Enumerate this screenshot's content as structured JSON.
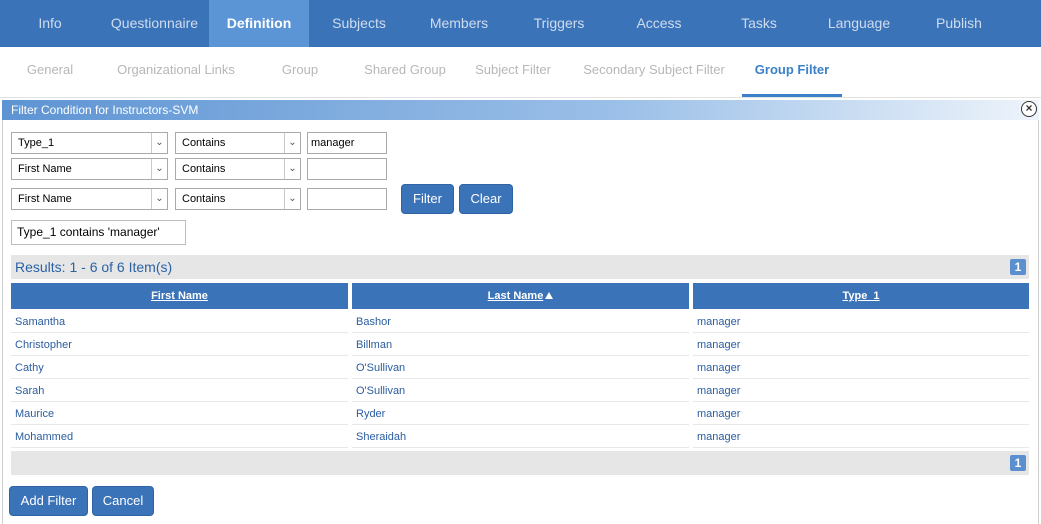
{
  "topnav": {
    "tabs": [
      "Info",
      "Questionnaire",
      "Definition",
      "Subjects",
      "Members",
      "Triggers",
      "Access",
      "Tasks",
      "Language",
      "Publish"
    ],
    "active": "Definition"
  },
  "subnav": {
    "tabs": [
      "General",
      "Organizational Links",
      "Group",
      "Shared Group",
      "Subject Filter",
      "Secondary Subject Filter",
      "Group Filter"
    ],
    "active": "Group Filter"
  },
  "dialog": {
    "title": "Filter Condition for Instructors-SVM",
    "close_icon": "close-icon"
  },
  "filters": [
    {
      "field": "Type_1",
      "operator": "Contains",
      "value": "manager"
    },
    {
      "field": "First Name",
      "operator": "Contains",
      "value": ""
    },
    {
      "field": "First Name",
      "operator": "Contains",
      "value": ""
    }
  ],
  "buttons": {
    "filter": "Filter",
    "clear": "Clear",
    "add_filter": "Add Filter",
    "cancel": "Cancel"
  },
  "summary": "Type_1 contains 'manager'",
  "results": {
    "label": "Results: 1 - 6 of 6 Item(s)",
    "page": "1"
  },
  "table": {
    "columns": [
      "First Name",
      "Last Name",
      "Type_1"
    ],
    "sort_icon": "sort-ascending-icon",
    "rows": [
      [
        "Samantha",
        "Bashor",
        "manager"
      ],
      [
        "Christopher",
        "Billman",
        "manager"
      ],
      [
        "Cathy",
        "O'Sullivan",
        "manager"
      ],
      [
        "Sarah",
        "O'Sullivan",
        "manager"
      ],
      [
        "Maurice",
        "Ryder",
        "manager"
      ],
      [
        "Mohammed",
        "Sheraidah",
        "manager"
      ]
    ]
  },
  "colors": {
    "nav_bg": "#3b73b9",
    "nav_active": "#5b95d6",
    "accent": "#3b80c9"
  }
}
